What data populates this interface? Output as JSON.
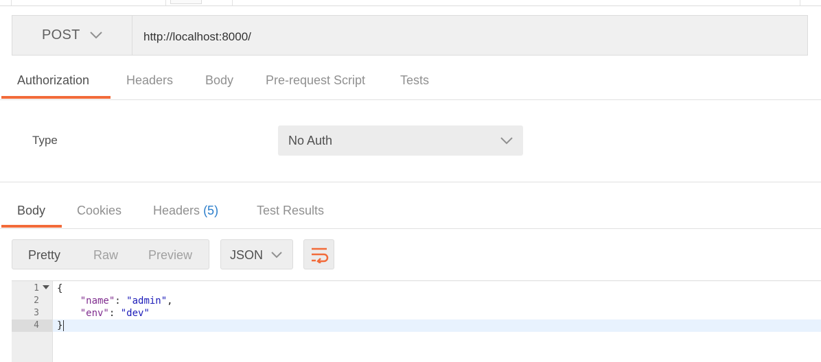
{
  "request": {
    "method": "POST",
    "url": "http://localhost:8000/"
  },
  "request_tabs": [
    {
      "label": "Authorization",
      "active": true
    },
    {
      "label": "Headers",
      "active": false
    },
    {
      "label": "Body",
      "active": false
    },
    {
      "label": "Pre-request Script",
      "active": false
    },
    {
      "label": "Tests",
      "active": false
    }
  ],
  "auth": {
    "type_label": "Type",
    "type_value": "No Auth"
  },
  "response_tabs": [
    {
      "label": "Body",
      "active": true
    },
    {
      "label": "Cookies",
      "active": false
    },
    {
      "label": "Headers",
      "count": "(5)",
      "active": false
    },
    {
      "label": "Test Results",
      "active": false
    }
  ],
  "view_modes": [
    {
      "label": "Pretty",
      "active": true
    },
    {
      "label": "Raw",
      "active": false
    },
    {
      "label": "Preview",
      "active": false
    }
  ],
  "format": "JSON",
  "wrap_icon": "wrap-lines-icon",
  "editor": {
    "line_numbers": [
      "1",
      "2",
      "3",
      "4"
    ],
    "lines": {
      "l1": "{",
      "l2_key": "\"name\"",
      "l2_sep": ": ",
      "l2_val": "\"admin\"",
      "l2_end": ",",
      "l3_key": "\"env\"",
      "l3_sep": ": ",
      "l3_val": "\"dev\"",
      "l4": "}"
    }
  },
  "colors": {
    "accent": "#f26b3a",
    "link": "#2b7ecb",
    "json_key": "#7f2c8e",
    "json_string": "#1a1ab8"
  }
}
